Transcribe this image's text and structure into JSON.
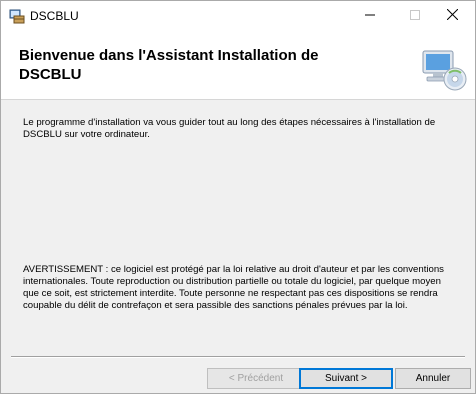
{
  "window": {
    "title": "DSCBLU",
    "controls": {
      "minimize_icon": "minimize-icon",
      "maximize_icon": "maximize-icon",
      "close_icon": "close-icon"
    }
  },
  "header": {
    "title": "Bienvenue dans l'Assistant Installation de DSCBLU",
    "image_icon": "computer-disc-icon"
  },
  "content": {
    "intro": "Le programme d'installation va vous guider tout au long des étapes nécessaires à l'installation de DSCBLU sur votre ordinateur.",
    "warning": "AVERTISSEMENT : ce logiciel est protégé par la loi relative au droit d'auteur et par les conventions internationales. Toute reproduction ou distribution partielle ou totale du logiciel, par quelque moyen que ce soit, est strictement interdite. Toute personne ne respectant pas ces dispositions se rendra coupable du délit de contrefaçon et sera passible des sanctions pénales prévues par la loi."
  },
  "buttons": {
    "back": "< Précédent",
    "next": "Suivant >",
    "cancel": "Annuler"
  },
  "colors": {
    "focus_border": "#0078d7",
    "window_bg": "#f0f0f0"
  }
}
